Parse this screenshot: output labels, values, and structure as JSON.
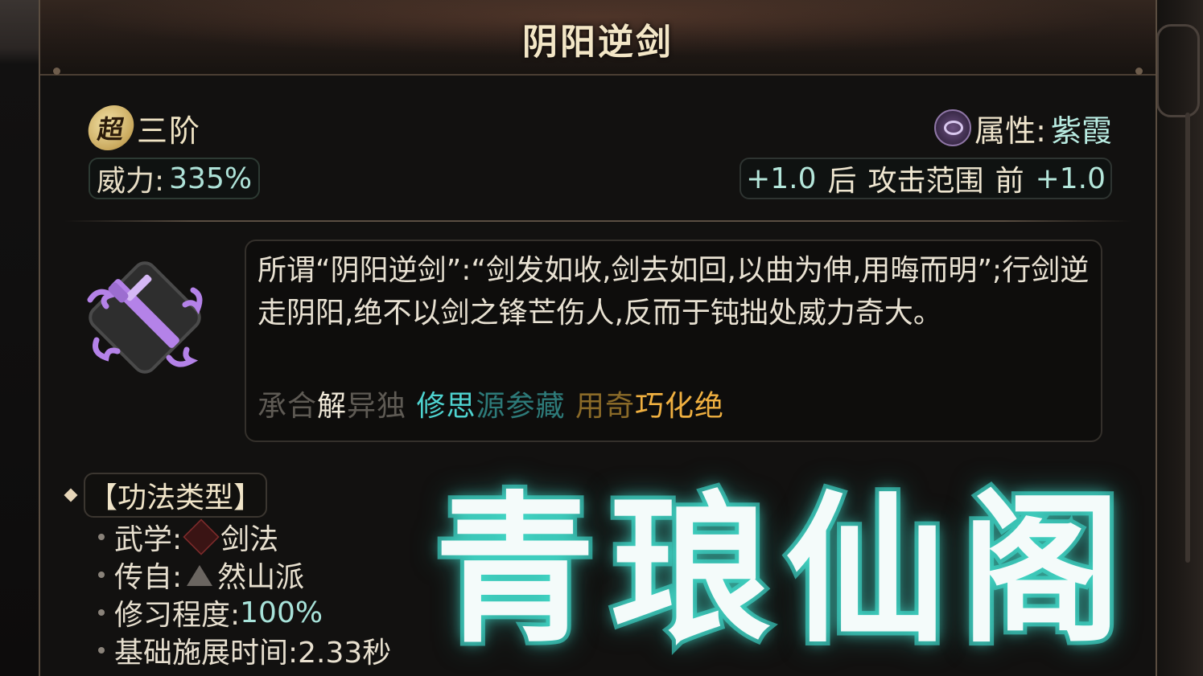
{
  "skill": {
    "name": "阴阳逆剑",
    "tier_badge": "超",
    "tier_label": "三阶",
    "power_label": "威力:",
    "power_value": "335%",
    "attribute_label": "属性:",
    "attribute_value": "紫霞",
    "attribute_icon": "purple-cloud-icon",
    "range": {
      "back_value": "+1.0",
      "back_label": "后",
      "range_label": "攻击范围",
      "front_label": "前",
      "front_value": "+1.0"
    },
    "icon": "sword-cloud-icon",
    "description": "所谓“阴阳逆剑”:“剑发如收,剑去如回,以曲为伸,用晦而明”;行剑逆走阴阳,绝不以剑之锋芒伤人,反而于钝拙处威力奇大。",
    "grades": [
      {
        "text": "承合",
        "style": "dim"
      },
      {
        "text": "解",
        "style": "white"
      },
      {
        "text": "异独 ",
        "style": "dim"
      },
      {
        "text": "修思",
        "style": "cyan"
      },
      {
        "text": "源参藏 ",
        "style": "teal-dim"
      },
      {
        "text": "用奇",
        "style": "orange-dim"
      },
      {
        "text": "巧化绝",
        "style": "orange"
      }
    ]
  },
  "type_section": {
    "title": "【功法类型】",
    "rows": [
      {
        "label": "武学:",
        "value": "剑法",
        "icon": "sword-icon"
      },
      {
        "label": "传自:",
        "value": "然山派",
        "icon": "mountain-icon"
      },
      {
        "label": "修习程度:",
        "value": "100%"
      },
      {
        "label": "基础施展时间:",
        "value": "2.33秒"
      }
    ]
  },
  "watermark": "青琅仙阁",
  "colors": {
    "cyan": "#4ed3d0",
    "orange": "#f0b040",
    "purple": "#b482e8",
    "gold_text": "#f3e6c6"
  }
}
